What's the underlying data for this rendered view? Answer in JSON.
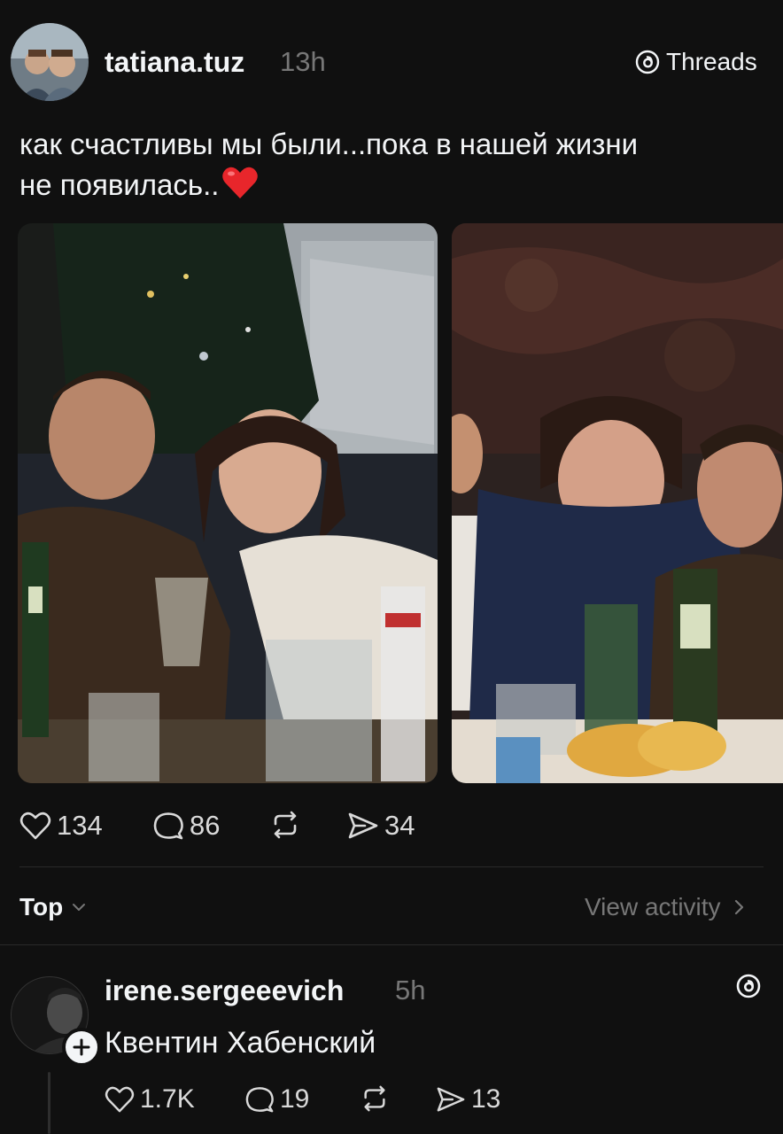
{
  "post": {
    "username": "tatiana.tuz",
    "time": "13h",
    "brand_label": "Threads",
    "text_line1": "как счастливы мы были...пока в нашей жизни",
    "text_line2": "не появилась..",
    "emoji": "❤️",
    "likes": "134",
    "comments": "86",
    "shares": "34"
  },
  "sort": {
    "label": "Top",
    "view_activity": "View activity"
  },
  "reply": {
    "username": "irene.sergeeevich",
    "time": "5h",
    "text": "Квентин Хабенский",
    "likes": "1.7K",
    "comments": "19",
    "shares": "13"
  },
  "colors": {
    "background": "#101010",
    "text": "#f3f5f7",
    "muted": "#777777",
    "heart": "#e8262b"
  },
  "icons": [
    "threads-logo-icon",
    "heart-icon",
    "comment-icon",
    "repost-icon",
    "share-icon",
    "chevron-down-icon",
    "chevron-right-icon",
    "plus-icon"
  ]
}
